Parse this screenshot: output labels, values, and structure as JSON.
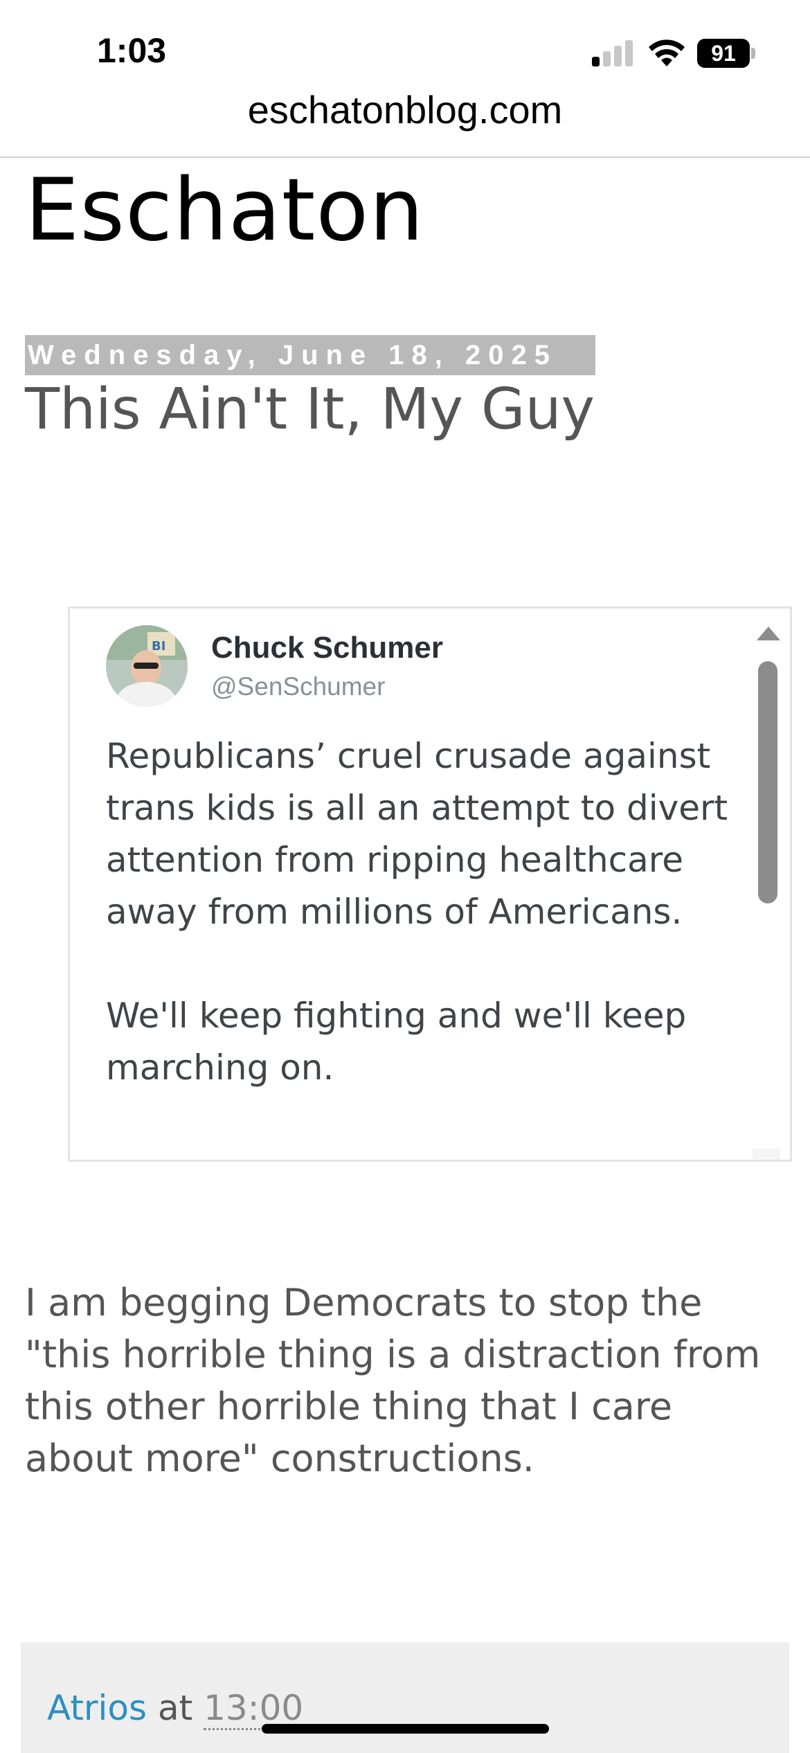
{
  "status_bar": {
    "time": "1:03",
    "battery": "91",
    "signal_bars_active": 1,
    "signal_bars_total": 4
  },
  "browser": {
    "url": "eschatonblog.com"
  },
  "blog": {
    "title": "Eschaton"
  },
  "post": {
    "date": "Wednesday, June 18, 2025",
    "title": "This Ain't It, My Guy",
    "tweet": {
      "name": "Chuck Schumer",
      "handle": "@SenSchumer",
      "text": "Republicans’ cruel crusade against trans kids is all an attempt to divert attention from ripping healthcare away from millions of Americans.\n\nWe'll keep fighting and we'll keep marching on."
    },
    "body": "I am begging Democrats to stop the \"this horrible thing is a distraction from this other horrible thing that I care about more\" constructions.",
    "footer": {
      "author": "Atrios",
      "at": "at",
      "time": "13:00"
    }
  },
  "colors": {
    "date_bg": "#b9b9b9",
    "title_gray": "#555555",
    "link_blue": "#2b8fc0",
    "footer_bg": "#eeeeee"
  },
  "icons": [
    "signal-icon",
    "wifi-icon",
    "battery-icon",
    "avatar"
  ]
}
